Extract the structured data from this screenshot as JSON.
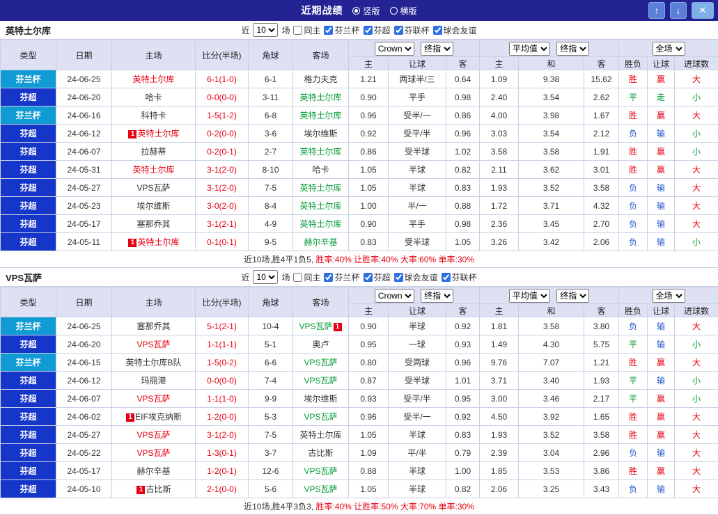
{
  "titlebar": {
    "title": "近期战绩",
    "vertical_label": "竖版",
    "horizontal_label": "横版",
    "up_icon": "↑",
    "down_icon": "↓",
    "close_icon": "✕"
  },
  "labels": {
    "near": "近",
    "games": "场",
    "same_home": "同主"
  },
  "columns": {
    "type": "类型",
    "date": "日期",
    "home": "主场",
    "score": "比分(半场)",
    "corner": "角球",
    "away": "客场",
    "odds_group1": {
      "select1": "Crown",
      "select2": "终指",
      "sub": [
        "主",
        "让球",
        "客"
      ]
    },
    "odds_group2": {
      "select1": "平均值",
      "select2": "终指",
      "sub": [
        "主",
        "和",
        "客"
      ]
    },
    "result_group": {
      "select1": "全场",
      "sub": [
        "胜负",
        "让球",
        "进球数"
      ]
    }
  },
  "colors": {
    "leagues": {
      "芬兰杯": "#119bd4",
      "芬超": "#1536c8"
    },
    "team": {
      "red": "#e60012",
      "green": "#009933",
      "black": "#333333"
    },
    "results": {
      "胜": "#e60012",
      "赢": "#e60012",
      "大": "#e60012",
      "平": "#009933",
      "走": "#009933",
      "小": "#009933",
      "负": "#2255cc",
      "输": "#2255cc"
    }
  },
  "sections": [
    {
      "team": "英特土尔库",
      "filter": {
        "count": "10",
        "leagues": [
          "芬兰杯",
          "芬超",
          "芬联杯",
          "球会友谊"
        ]
      },
      "rows": [
        {
          "league": "芬兰杯",
          "date": "24-06-25",
          "home": {
            "name": "英特土尔库",
            "color": "red"
          },
          "score": "6-1(1-0)",
          "corner": "6-1",
          "away": {
            "name": "格力夫克",
            "color": "black"
          },
          "odds": [
            "1.21",
            "两球半/三",
            "0.64"
          ],
          "avg": [
            "1.09",
            "9.38",
            "15.62"
          ],
          "results": [
            "胜",
            "赢",
            "大"
          ]
        },
        {
          "league": "芬超",
          "date": "24-06-20",
          "home": {
            "name": "哈卡",
            "color": "black"
          },
          "score": "0-0(0-0)",
          "corner": "3-11",
          "away": {
            "name": "英特土尔库",
            "color": "green"
          },
          "odds": [
            "0.90",
            "平手",
            "0.98"
          ],
          "avg": [
            "2.40",
            "3.54",
            "2.62"
          ],
          "results": [
            "平",
            "走",
            "小"
          ]
        },
        {
          "league": "芬兰杯",
          "date": "24-06-16",
          "home": {
            "name": "科特卡",
            "color": "black"
          },
          "score": "1-5(1-2)",
          "corner": "6-8",
          "away": {
            "name": "英特土尔库",
            "color": "green"
          },
          "odds": [
            "0.96",
            "受半/一",
            "0.86"
          ],
          "avg": [
            "4.00",
            "3.98",
            "1.67"
          ],
          "results": [
            "胜",
            "赢",
            "大"
          ]
        },
        {
          "league": "芬超",
          "date": "24-06-12",
          "home": {
            "name": "英特土尔库",
            "color": "red",
            "badge": "1",
            "badge_pos": "before"
          },
          "score": "0-2(0-0)",
          "corner": "3-6",
          "away": {
            "name": "埃尔维斯",
            "color": "black"
          },
          "odds": [
            "0.92",
            "受平/半",
            "0.96"
          ],
          "avg": [
            "3.03",
            "3.54",
            "2.12"
          ],
          "results": [
            "负",
            "输",
            "小"
          ]
        },
        {
          "league": "芬超",
          "date": "24-06-07",
          "home": {
            "name": "拉赫蒂",
            "color": "black"
          },
          "score": "0-2(0-1)",
          "corner": "2-7",
          "away": {
            "name": "英特土尔库",
            "color": "green"
          },
          "odds": [
            "0.86",
            "受半球",
            "1.02"
          ],
          "avg": [
            "3.58",
            "3.58",
            "1.91"
          ],
          "results": [
            "胜",
            "赢",
            "小"
          ]
        },
        {
          "league": "芬超",
          "date": "24-05-31",
          "home": {
            "name": "英特土尔库",
            "color": "red"
          },
          "score": "3-1(2-0)",
          "corner": "8-10",
          "away": {
            "name": "哈卡",
            "color": "black"
          },
          "odds": [
            "1.05",
            "半球",
            "0.82"
          ],
          "avg": [
            "2.11",
            "3.62",
            "3.01"
          ],
          "results": [
            "胜",
            "赢",
            "大"
          ]
        },
        {
          "league": "芬超",
          "date": "24-05-27",
          "home": {
            "name": "VPS瓦萨",
            "color": "black"
          },
          "score": "3-1(2-0)",
          "corner": "7-5",
          "away": {
            "name": "英特土尔库",
            "color": "green"
          },
          "odds": [
            "1.05",
            "半球",
            "0.83"
          ],
          "avg": [
            "1.93",
            "3.52",
            "3.58"
          ],
          "results": [
            "负",
            "输",
            "大"
          ]
        },
        {
          "league": "芬超",
          "date": "24-05-23",
          "home": {
            "name": "埃尔维斯",
            "color": "black"
          },
          "score": "3-0(2-0)",
          "corner": "8-4",
          "away": {
            "name": "英特土尔库",
            "color": "green"
          },
          "odds": [
            "1.00",
            "半/一",
            "0.88"
          ],
          "avg": [
            "1.72",
            "3.71",
            "4.32"
          ],
          "results": [
            "负",
            "输",
            "大"
          ]
        },
        {
          "league": "芬超",
          "date": "24-05-17",
          "home": {
            "name": "塞那乔其",
            "color": "black"
          },
          "score": "3-1(2-1)",
          "corner": "4-9",
          "away": {
            "name": "英特土尔库",
            "color": "green"
          },
          "odds": [
            "0.90",
            "平手",
            "0.98"
          ],
          "avg": [
            "2.36",
            "3.45",
            "2.70"
          ],
          "results": [
            "负",
            "输",
            "大"
          ]
        },
        {
          "league": "芬超",
          "date": "24-05-11",
          "home": {
            "name": "英特土尔库",
            "color": "red",
            "badge": "1",
            "badge_pos": "before"
          },
          "score": "0-1(0-1)",
          "corner": "9-5",
          "away": {
            "name": "赫尔辛基",
            "color": "green"
          },
          "odds": [
            "0.83",
            "受半球",
            "1.05"
          ],
          "avg": [
            "3.26",
            "3.42",
            "2.06"
          ],
          "results": [
            "负",
            "输",
            "小"
          ]
        }
      ],
      "summary": [
        {
          "text": "近10场,胜4平1负5, ",
          "color": "#333333"
        },
        {
          "text": "胜率:40%",
          "color": "#e60012"
        },
        {
          "text": " 让胜率:40%",
          "color": "#e60012"
        },
        {
          "text": " 大率:60%",
          "color": "#e60012"
        },
        {
          "text": " 单率:30%",
          "color": "#e60012"
        }
      ]
    },
    {
      "team": "VPS瓦萨",
      "filter": {
        "count": "10",
        "leagues": [
          "芬兰杯",
          "芬超",
          "球会友谊",
          "芬联杯"
        ]
      },
      "rows": [
        {
          "league": "芬兰杯",
          "date": "24-06-25",
          "home": {
            "name": "塞那乔其",
            "color": "black"
          },
          "score": "5-1(2-1)",
          "corner": "10-4",
          "away": {
            "name": "VPS瓦萨",
            "color": "green",
            "badge": "1",
            "badge_pos": "after"
          },
          "odds": [
            "0.90",
            "半球",
            "0.92"
          ],
          "avg": [
            "1.81",
            "3.58",
            "3.80"
          ],
          "results": [
            "负",
            "输",
            "大"
          ]
        },
        {
          "league": "芬超",
          "date": "24-06-20",
          "home": {
            "name": "VPS瓦萨",
            "color": "red"
          },
          "score": "1-1(1-1)",
          "corner": "5-1",
          "away": {
            "name": "奥卢",
            "color": "black"
          },
          "odds": [
            "0.95",
            "一球",
            "0.93"
          ],
          "avg": [
            "1.49",
            "4.30",
            "5.75"
          ],
          "results": [
            "平",
            "输",
            "小"
          ]
        },
        {
          "league": "芬兰杯",
          "date": "24-06-15",
          "home": {
            "name": "英特土尔库B队",
            "color": "black"
          },
          "score": "1-5(0-2)",
          "corner": "6-6",
          "away": {
            "name": "VPS瓦萨",
            "color": "green"
          },
          "odds": [
            "0.80",
            "受两球",
            "0.96"
          ],
          "avg": [
            "9.76",
            "7.07",
            "1.21"
          ],
          "results": [
            "胜",
            "赢",
            "大"
          ]
        },
        {
          "league": "芬超",
          "date": "24-06-12",
          "home": {
            "name": "玛丽港",
            "color": "black"
          },
          "score": "0-0(0-0)",
          "corner": "7-4",
          "away": {
            "name": "VPS瓦萨",
            "color": "green"
          },
          "odds": [
            "0.87",
            "受半球",
            "1.01"
          ],
          "avg": [
            "3.71",
            "3.40",
            "1.93"
          ],
          "results": [
            "平",
            "输",
            "小"
          ]
        },
        {
          "league": "芬超",
          "date": "24-06-07",
          "home": {
            "name": "VPS瓦萨",
            "color": "red"
          },
          "score": "1-1(1-0)",
          "corner": "9-9",
          "away": {
            "name": "埃尔维斯",
            "color": "black"
          },
          "odds": [
            "0.93",
            "受平/半",
            "0.95"
          ],
          "avg": [
            "3.00",
            "3.46",
            "2.17"
          ],
          "results": [
            "平",
            "赢",
            "小"
          ]
        },
        {
          "league": "芬超",
          "date": "24-06-02",
          "home": {
            "name": "EIF埃克纳斯",
            "color": "black",
            "badge": "1",
            "badge_pos": "before"
          },
          "score": "1-2(0-0)",
          "corner": "5-3",
          "away": {
            "name": "VPS瓦萨",
            "color": "green"
          },
          "odds": [
            "0.96",
            "受半/一",
            "0.92"
          ],
          "avg": [
            "4.50",
            "3.92",
            "1.65"
          ],
          "results": [
            "胜",
            "赢",
            "大"
          ]
        },
        {
          "league": "芬超",
          "date": "24-05-27",
          "home": {
            "name": "VPS瓦萨",
            "color": "red"
          },
          "score": "3-1(2-0)",
          "corner": "7-5",
          "away": {
            "name": "英特土尔库",
            "color": "black"
          },
          "odds": [
            "1.05",
            "半球",
            "0.83"
          ],
          "avg": [
            "1.93",
            "3.52",
            "3.58"
          ],
          "results": [
            "胜",
            "赢",
            "大"
          ]
        },
        {
          "league": "芬超",
          "date": "24-05-22",
          "home": {
            "name": "VPS瓦萨",
            "color": "red"
          },
          "score": "1-3(0-1)",
          "corner": "3-7",
          "away": {
            "name": "古比斯",
            "color": "black"
          },
          "odds": [
            "1.09",
            "平/半",
            "0.79"
          ],
          "avg": [
            "2.39",
            "3.04",
            "2.96"
          ],
          "results": [
            "负",
            "输",
            "大"
          ]
        },
        {
          "league": "芬超",
          "date": "24-05-17",
          "home": {
            "name": "赫尔辛基",
            "color": "black"
          },
          "score": "1-2(0-1)",
          "corner": "12-6",
          "away": {
            "name": "VPS瓦萨",
            "color": "green"
          },
          "odds": [
            "0.88",
            "半球",
            "1.00"
          ],
          "avg": [
            "1.85",
            "3.53",
            "3.86"
          ],
          "results": [
            "胜",
            "赢",
            "大"
          ]
        },
        {
          "league": "芬超",
          "date": "24-05-10",
          "home": {
            "name": "古比斯",
            "color": "black",
            "badge": "1",
            "badge_pos": "before"
          },
          "score": "2-1(0-0)",
          "corner": "5-6",
          "away": {
            "name": "VPS瓦萨",
            "color": "green"
          },
          "odds": [
            "1.05",
            "半球",
            "0.82"
          ],
          "avg": [
            "2.06",
            "3.25",
            "3.43"
          ],
          "results": [
            "负",
            "输",
            "大"
          ]
        }
      ],
      "summary": [
        {
          "text": "近10场,胜4平3负3, ",
          "color": "#333333"
        },
        {
          "text": "胜率:40%",
          "color": "#e60012"
        },
        {
          "text": " 让胜率:50%",
          "color": "#e60012"
        },
        {
          "text": " 大率:70%",
          "color": "#e60012"
        },
        {
          "text": " 单率:30%",
          "color": "#e60012"
        }
      ]
    }
  ]
}
